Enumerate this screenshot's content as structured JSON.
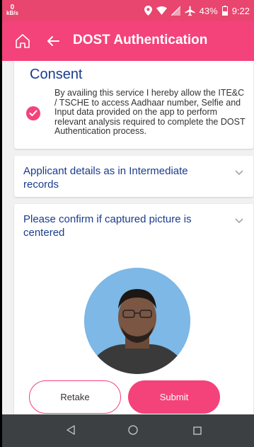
{
  "status_bar": {
    "net_speed_value": "0",
    "net_speed_unit": "kB/s",
    "battery_percent": "43%",
    "time": "9:22",
    "icons": [
      "location-icon",
      "wifi-icon",
      "signal-icon",
      "airplane-icon",
      "battery-icon"
    ]
  },
  "app_bar": {
    "title": "DOST Authentication",
    "home_icon": "home-icon",
    "back_icon": "back-arrow-icon",
    "color": "#f4427a"
  },
  "consent": {
    "title": "Consent",
    "text": "By availing this service I hereby allow the ITE&C / TSCHE to access Aadhaar number, Selfie and Input data provided on the app to perform relevant analysis required to complete the DOST Authentication process.",
    "checked": true
  },
  "sections": [
    {
      "title": "Applicant details as in Intermediate records",
      "icon": "chevron-down-icon"
    },
    {
      "title": "Please confirm if captured picture is centered",
      "icon": "chevron-down-icon"
    }
  ],
  "buttons": {
    "retake": "Retake",
    "submit": "Submit"
  },
  "nav": {
    "icons": [
      "nav-back-icon",
      "nav-home-icon",
      "nav-recents-icon"
    ]
  },
  "colors": {
    "accent": "#f4427a",
    "heading": "#1a3c8c",
    "nav_bar": "#3d4043"
  }
}
